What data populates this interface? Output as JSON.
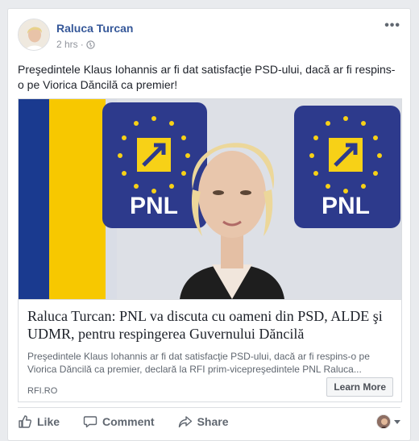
{
  "post": {
    "author": "Raluca Turcan",
    "timestamp": "2 hrs",
    "separator": "·",
    "privacy_icon": "globe-icon",
    "more_label": "•••",
    "text": "Preşedintele Klaus Iohannis ar fi dat satisfacţie PSD-ului, dacă ar fi respins-o pe Viorica Dăncilă ca premier!"
  },
  "link_preview": {
    "image_logo_text": "PNL",
    "title": "Raluca Turcan: PNL va discuta cu oameni din PSD, ALDE şi UDMR, pentru respingerea Guvernului Dăncilă",
    "description": "Preşedintele Klaus Iohannis ar fi dat satisfacţie PSD-ului, dacă ar fi respins-o pe Viorica Dăncilă ca premier, declară la RFI prim-vicepreşedintele PNL Raluca...",
    "domain": "RFI.RO",
    "cta_label": "Learn More"
  },
  "actions": {
    "like": "Like",
    "comment": "Comment",
    "share": "Share"
  },
  "colors": {
    "author_link": "#365899",
    "pnl_blue": "#2d3a8c",
    "pnl_yellow": "#f7d117",
    "flag_blue": "#1a3a8f",
    "flag_yellow": "#f7c800"
  }
}
